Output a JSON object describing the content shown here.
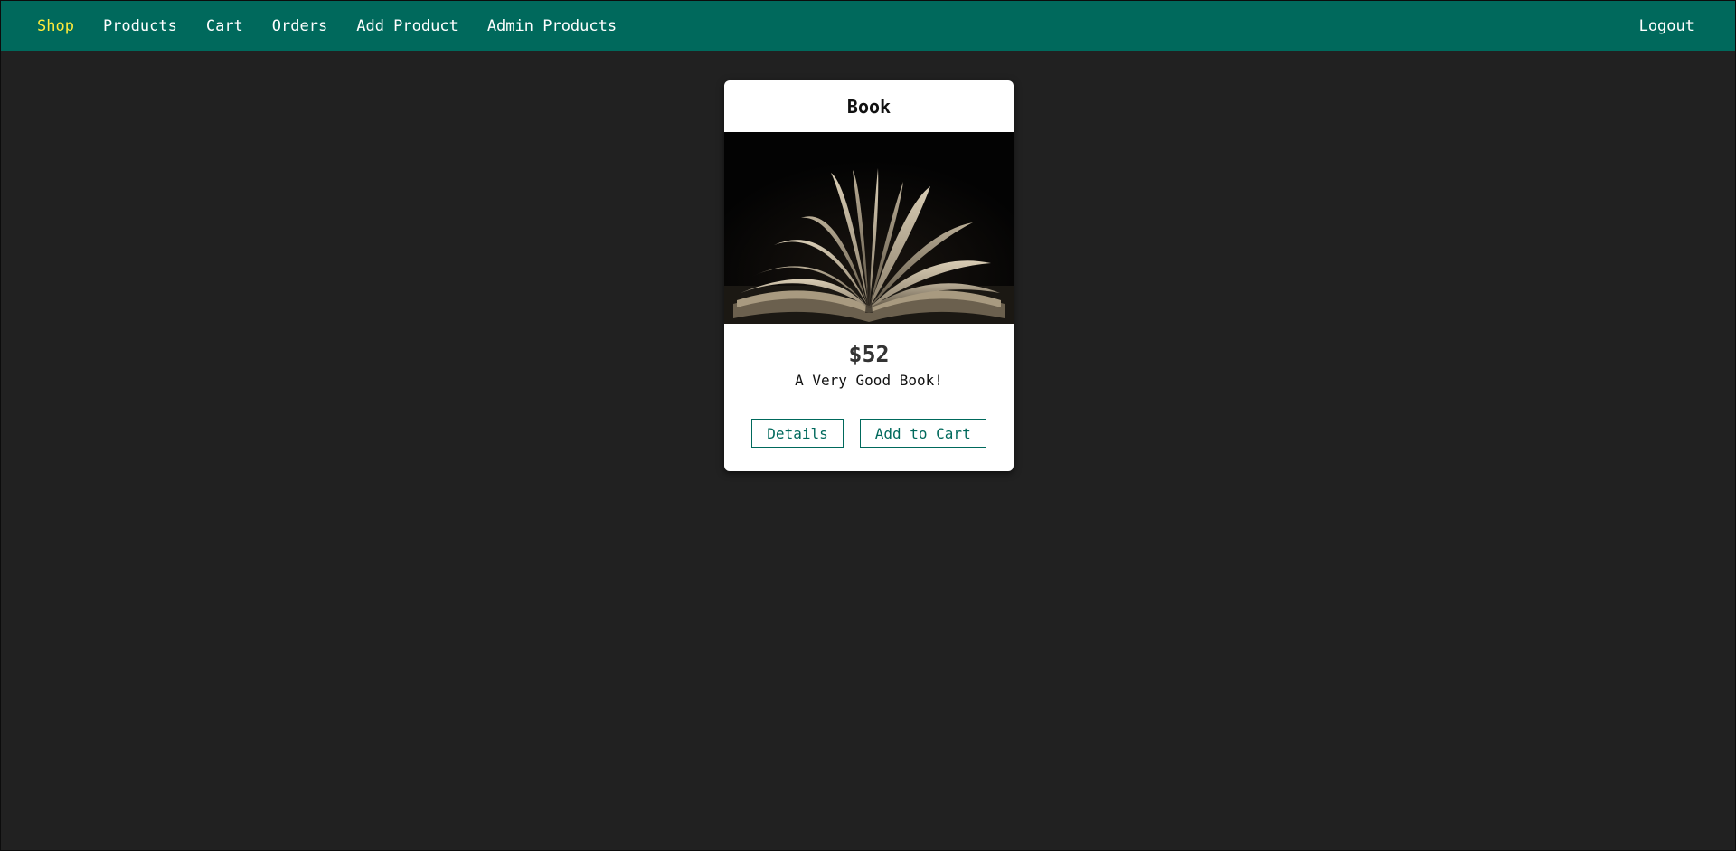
{
  "nav": {
    "items": [
      {
        "label": "Shop",
        "active": true
      },
      {
        "label": "Products",
        "active": false
      },
      {
        "label": "Cart",
        "active": false
      },
      {
        "label": "Orders",
        "active": false
      },
      {
        "label": "Add Product",
        "active": false
      },
      {
        "label": "Admin Products",
        "active": false
      }
    ],
    "logout_label": "Logout"
  },
  "colors": {
    "header_bg": "#00695c",
    "active_nav": "#ffeb3b",
    "page_bg": "#212121",
    "accent": "#00695c"
  },
  "product": {
    "title": "Book",
    "image_icon": "open-book-image",
    "price": "$52",
    "description": "A Very Good Book!",
    "details_label": "Details",
    "add_to_cart_label": "Add to Cart"
  }
}
